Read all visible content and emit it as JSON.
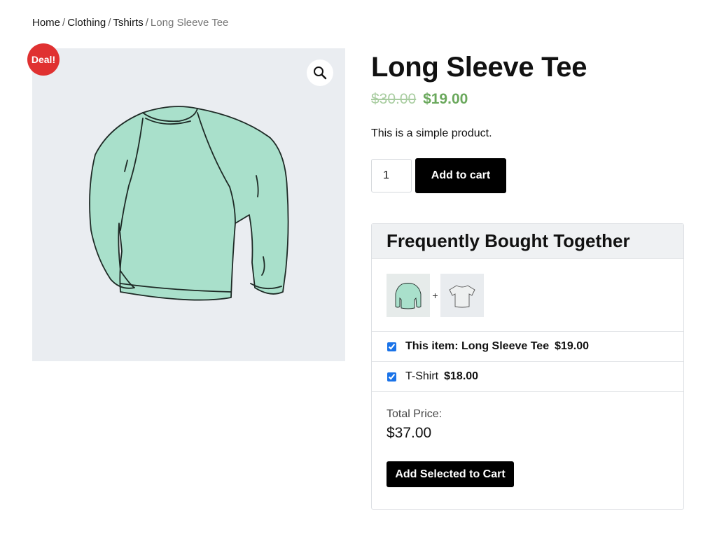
{
  "breadcrumb": {
    "home": "Home",
    "sep1": "/",
    "clothing": "Clothing",
    "sep2": "/",
    "tshirts": "Tshirts",
    "sep3": "/",
    "current": "Long Sleeve Tee"
  },
  "gallery": {
    "badge": "Deal!",
    "zoom_icon": "search-icon",
    "image": "long-sleeve-tee-image"
  },
  "product": {
    "title": "Long Sleeve Tee",
    "price_old": "$30.00",
    "price_new": "$19.00",
    "short_description": "This is a simple product.",
    "quantity": "1",
    "add_to_cart_label": "Add to cart"
  },
  "fbt": {
    "title": "Frequently Bought Together",
    "plus": "+",
    "items": [
      {
        "label": "This item: Long Sleeve Tee",
        "price": "$19.00",
        "checked": true
      },
      {
        "label": "T-Shirt",
        "price": "$18.00",
        "checked": true
      }
    ],
    "total_label": "Total Price:",
    "total_value": "$37.00",
    "add_selected_label": "Add Selected to Cart"
  },
  "colors": {
    "badge": "#e03131",
    "price_new": "#6aa85c",
    "price_old": "#a9cda1",
    "button": "#000000",
    "gallery_bg": "#eaedf1"
  }
}
